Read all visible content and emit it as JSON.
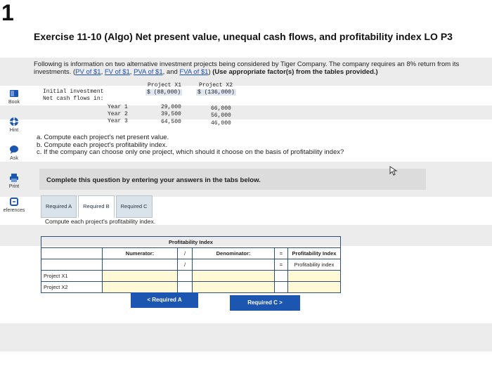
{
  "page_marker": "1",
  "title": "Exercise 11-10 (Algo) Net present value, unequal cash flows, and profitability index LO P3",
  "intro": {
    "text_before": "Following is information on two alternative investment projects being considered by Tiger Company. The company requires an 8% return from its investments. (",
    "links": [
      "PV of $1",
      "FV of $1",
      "PVA of $1",
      "FVA of $1"
    ],
    "text_after": ") ",
    "bold_note": "(Use appropriate factor(s) from the tables provided.)"
  },
  "sidebar": {
    "items": [
      {
        "label": "Book",
        "icon": "book-icon"
      },
      {
        "label": "Hint",
        "icon": "lifebuoy-icon"
      },
      {
        "label": "Ask",
        "icon": "speech-bubble-icon"
      },
      {
        "label": "Print",
        "icon": "printer-icon"
      },
      {
        "label": "eferences",
        "icon": "references-icon"
      }
    ]
  },
  "data_table": {
    "headers": {
      "project_x1": "Project X1",
      "project_x2": "Project X2",
      "x1_investment": "$ (88,000)",
      "x2_investment": "$ (136,000)"
    },
    "initial_investment_label": "Initial investment",
    "net_cash_flows_label": "Net cash flows in:",
    "years": [
      {
        "label": "Year 1",
        "x1": "29,000",
        "x2": "66,000"
      },
      {
        "label": "Year 2",
        "x1": "39,500",
        "x2": "56,000"
      },
      {
        "label": "Year 3",
        "x1": "64,500",
        "x2": "46,000"
      }
    ]
  },
  "questions": [
    "a. Compute each project's net present value.",
    "b. Compute each project's profitability index.",
    "c. If the company can choose only one project, which should it choose on the basis of profitability index?"
  ],
  "instruction": "Complete this question by entering your answers in the tabs below.",
  "tabs": [
    "Required A",
    "Required B",
    "Required C"
  ],
  "panel_text": "Compute each project's profitability index.",
  "pi_table": {
    "title": "Profitability Index",
    "numerator_label": "Numerator:",
    "divide_symbol": "/",
    "denominator_label": "Denominator:",
    "equals_symbol": "=",
    "result_label": "Profitability Index",
    "result_sub_label": "Profitability index",
    "rows": [
      "Project X1",
      "Project X2"
    ]
  },
  "nav": {
    "prev_label": "Required A",
    "next_label": "Required C",
    "prev_arrow": "<",
    "next_arrow": ">"
  },
  "colors": {
    "accent": "#1d56b0",
    "stripe": "#ececec",
    "table_border": "#2d4e7c",
    "input_fill": "#fff9d6"
  }
}
